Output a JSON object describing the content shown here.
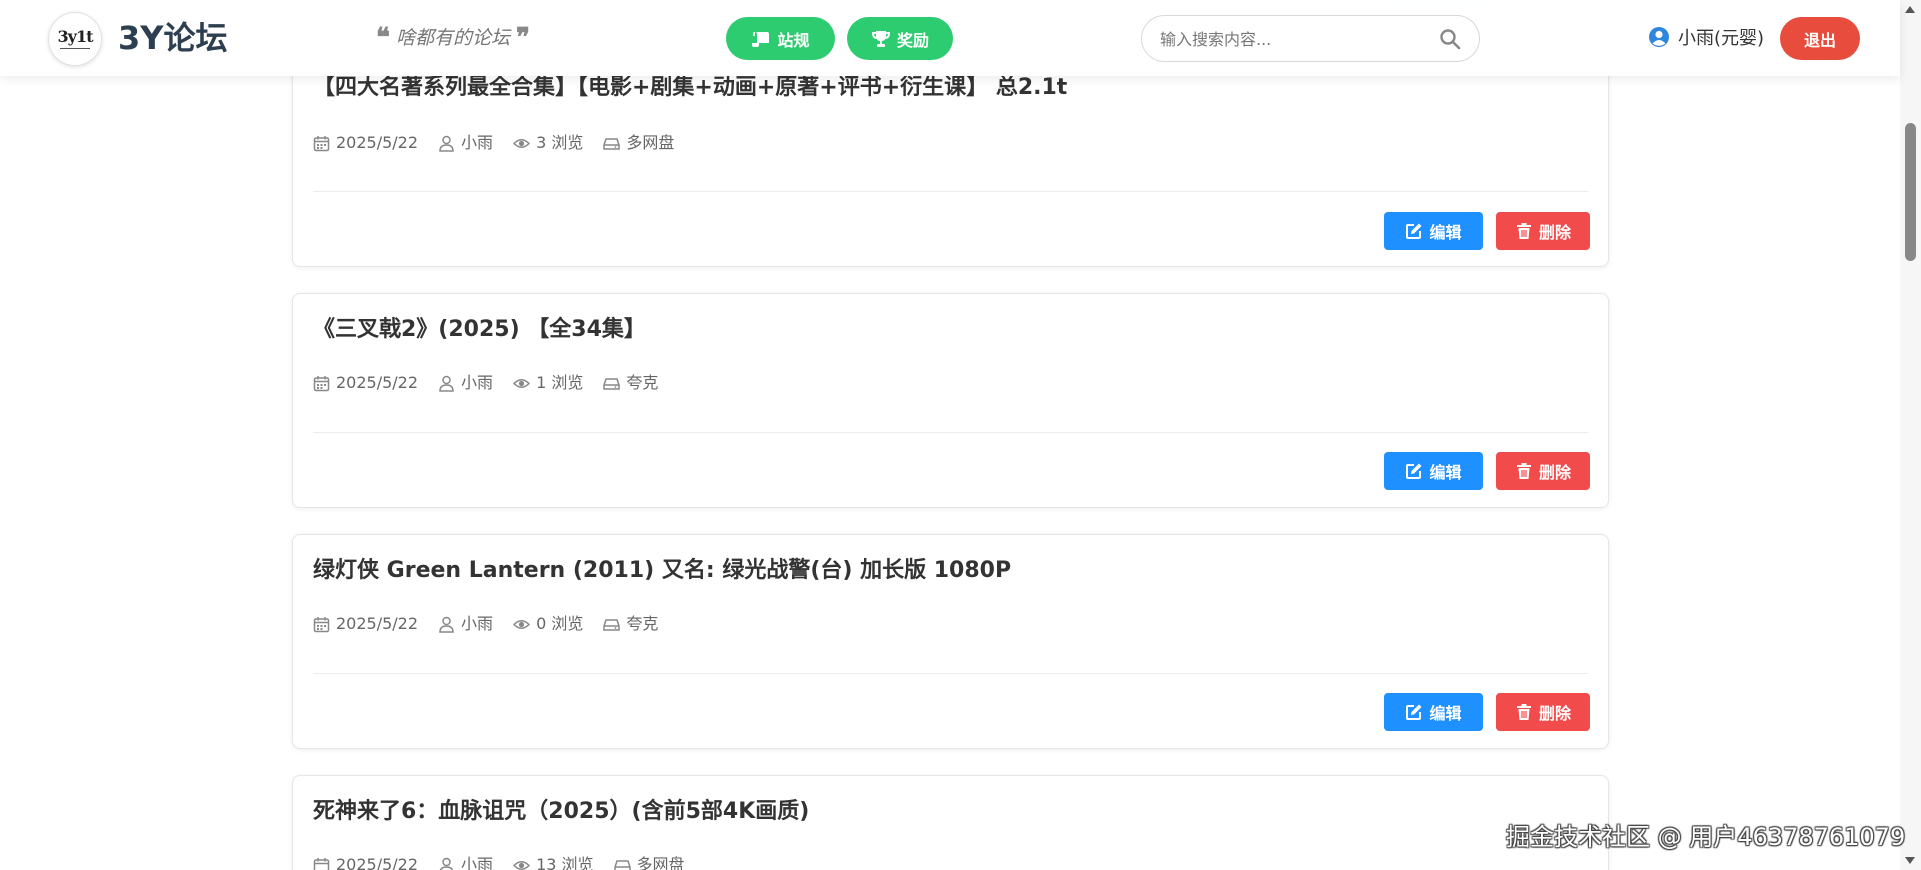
{
  "header": {
    "logo_text": "3y1t",
    "site_title": "3Y论坛",
    "slogan": "啥都有的论坛",
    "rules_label": "站规",
    "reward_label": "奖励",
    "search_placeholder": "输入搜索内容...",
    "username": "小雨(元婴)",
    "logout_label": "退出"
  },
  "actions": {
    "edit_label": "编辑",
    "delete_label": "删除"
  },
  "posts": [
    {
      "title": "【四大名著系列最全合集】【电影+剧集+动画+原著+评书+衍生课】 总2.1t",
      "date": "2025/5/22",
      "author": "小雨",
      "views": "3 浏览",
      "disk": "多网盘"
    },
    {
      "title": "《三叉戟2》(2025) 【全34集】",
      "date": "2025/5/22",
      "author": "小雨",
      "views": "1 浏览",
      "disk": "夸克"
    },
    {
      "title": "绿灯侠 Green Lantern (2011) 又名: 绿光战警(台) 加长版 1080P",
      "date": "2025/5/22",
      "author": "小雨",
      "views": "0 浏览",
      "disk": "夸克"
    },
    {
      "title": "死神来了6：血脉诅咒（2025）(含前5部4K画质)",
      "date": "2025/5/22",
      "author": "小雨",
      "views": "13 浏览",
      "disk": "多网盘"
    }
  ],
  "watermark": "掘金技术社区 @ 用户46378761079",
  "colors": {
    "accent_green": "#2ecc71",
    "logout_red": "#e74c3c",
    "edit_blue": "#1e90ff",
    "delete_red": "#f24b4b",
    "title_dark": "#2c3e50"
  }
}
